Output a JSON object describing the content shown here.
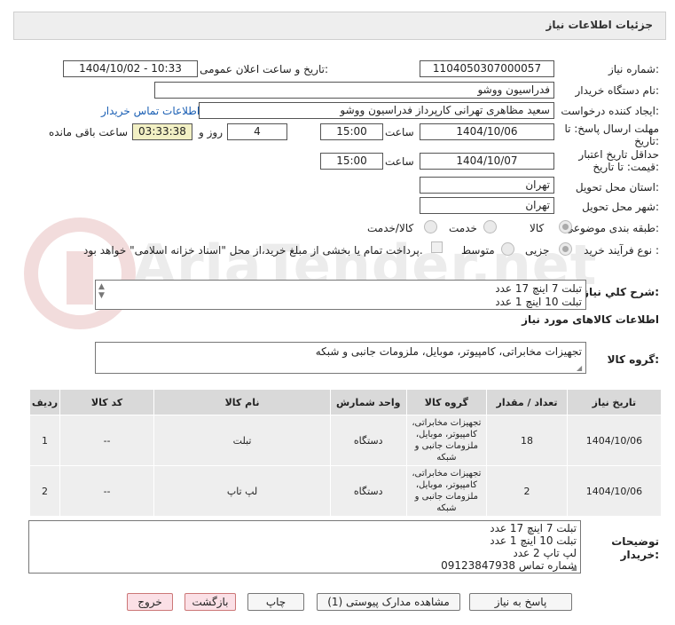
{
  "header": {
    "title": "جزئیات اطلاعات نیاز"
  },
  "form": {
    "need_number_label": "شماره نیاز:",
    "need_number": "1104050307000057",
    "announce_label": "تاریخ و ساعت اعلان عمومی:",
    "announce_value": "1404/10/02 - 10:33",
    "buyer_org_label": "نام دستگاه خریدار:",
    "buyer_org": "فدراسیون ووشو",
    "requester_label": "ایجاد کننده درخواست:",
    "requester": "سعید مظاهری تهرانی کارپرداز فدراسیون ووشو",
    "contact_link": "اطلاعات تماس خریدار",
    "deadline_label_1": "مهلت ارسال پاسخ: تا",
    "deadline_label_2": "تاریخ:",
    "deadline_date": "1404/10/06",
    "time_label": "ساعت",
    "deadline_time": "15:00",
    "days_value": "4",
    "days_label": "روز و",
    "remaining_time": "03:33:38",
    "remaining_label": "ساعت باقی مانده",
    "validity_label_1": "حداقل تاریخ اعتبار",
    "validity_label_2": "قیمت: تا تاریخ:",
    "validity_date": "1404/10/07",
    "validity_time": "15:00",
    "province_label": "استان محل تحویل:",
    "province": "تهران",
    "city_label": "شهر محل تحویل:",
    "city": "تهران",
    "category_label": "طبقه بندی موضوعی:",
    "category_options": [
      "کالا",
      "خدمت",
      "کالا/خدمت"
    ],
    "category_selected": "کالا",
    "purchase_type_label": "نوع فرآیند خرید :",
    "purchase_options": [
      "جزیی",
      "متوسط"
    ],
    "purchase_note": "پرداخت تمام یا بخشی از مبلغ خرید،از محل \"اسناد خزانه اسلامی\" خواهد بود.",
    "summary_label": "شرح کلي نياز:",
    "summary_line1": "تبلت 7 اینچ 17 عدد",
    "summary_line2": "تبلت 10 اینچ 1 عدد",
    "goods_info_title": "اطلاعات کالاهای مورد نیاز",
    "goods_group_label": "گروه کالا:",
    "goods_group": "تجهیزات مخابراتی، کامپیوتر، موبایل، ملزومات جانبی و شبکه"
  },
  "table": {
    "headers": [
      "ردیف",
      "کد کالا",
      "نام کالا",
      "واحد شمارش",
      "گروه کالا",
      "تعداد / مقدار",
      "تاریخ نیاز"
    ],
    "rows": [
      {
        "row": "1",
        "code": "--",
        "name": "تبلت",
        "unit": "دستگاه",
        "group": "تجهیزات مخابراتی، کامپیوتر، موبایل، ملزومات جانبی و شبکه",
        "qty": "18",
        "date": "1404/10/06"
      },
      {
        "row": "2",
        "code": "--",
        "name": "لپ تاپ",
        "unit": "دستگاه",
        "group": "تجهیزات مخابراتی، کامپیوتر، موبایل، ملزومات جانبی و شبکه",
        "qty": "2",
        "date": "1404/10/06"
      }
    ]
  },
  "notes": {
    "label_1": "توضیحات",
    "label_2": "خریدار:",
    "lines": [
      "تبلت 7 اینچ 17 عدد",
      "تبلت 10 اینچ 1 عدد",
      "لپ تاپ 2 عدد",
      "شماره تماس 09123847938"
    ]
  },
  "buttons": {
    "reply": "پاسخ به نیاز",
    "attachments": "مشاهده مدارک پیوستی (1)",
    "print": "چاپ",
    "back": "بازگشت",
    "exit": "خروج"
  },
  "watermark": "AriaTender.net"
}
